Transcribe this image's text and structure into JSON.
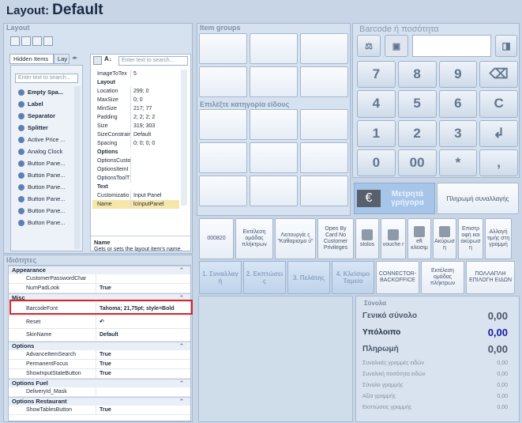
{
  "window": {
    "label": "Layout:",
    "value": "Default"
  },
  "layout_group": {
    "title": "Layout",
    "tabs": [
      "Hidden Items",
      "Lay"
    ],
    "search_placeholder": "Enter text to search...",
    "hidden_items": [
      "Empty Spa...",
      "Label",
      "Separator",
      "Splitter",
      "Active Price ...",
      "Analog Clock",
      "Button Pane...",
      "Button Pane...",
      "Button Pane...",
      "Button Pane...",
      "Button Pane...",
      "Button Pane..."
    ]
  },
  "props_mini": {
    "search_placeholder": "Enter text to search...",
    "rows": [
      {
        "k": "ImageToTex",
        "v": "5"
      },
      {
        "k": "Layout",
        "v": "",
        "cat": true
      },
      {
        "k": "Location",
        "v": "299; 0"
      },
      {
        "k": "MaxSize",
        "v": "0; 0"
      },
      {
        "k": "MinSize",
        "v": "217; 77"
      },
      {
        "k": "Padding",
        "v": "2; 2; 2; 2"
      },
      {
        "k": "Size",
        "v": "319; 303"
      },
      {
        "k": "SizeConstrain",
        "v": "Default"
      },
      {
        "k": "Spacing",
        "v": "0; 0; 0; 0"
      },
      {
        "k": "Options",
        "v": "",
        "cat": true
      },
      {
        "k": "OptionsCusto",
        "v": ""
      },
      {
        "k": "OptionsItemI",
        "v": ""
      },
      {
        "k": "OptionsToolT",
        "v": ""
      },
      {
        "k": "Text",
        "v": "",
        "cat": true
      },
      {
        "k": "Customizatio",
        "v": "Input Panel"
      },
      {
        "k": "Name",
        "v": "lcInputPanel"
      }
    ],
    "desc_title": "Name",
    "desc_text": "Gets or sets the layout item's name."
  },
  "item_groups": {
    "title": "Item groups",
    "category_title": "Επιλέξτε κατηγορία είδους"
  },
  "barcode": {
    "title": "Barcode ή ποσότητα",
    "keys": [
      "7",
      "8",
      "9",
      "⌫",
      "4",
      "5",
      "6",
      "C",
      "1",
      "2",
      "3",
      "↲",
      "0",
      "00",
      "*",
      ","
    ],
    "cash_label": "Μετρητά γρήγορα",
    "pay_label": "Πληρωμή συναλλαγής"
  },
  "function_buttons": [
    "000820",
    "Εκτέλεση ομάδας πλήκτρων",
    "Λειτουργίε ς \"Καθαρισμο ύ\"",
    "Open By Card No Customer Privileges",
    "stolos",
    "vouche r",
    "eft κλεισιμ",
    "Ακύρωσ η",
    "Επιστρ οφή και ακύρωσ η",
    "Αλλαγή τιμής στη γραμμή"
  ],
  "tab_buttons": [
    "1. Συναλλαγ ή",
    "2. Εκπτώσει ς",
    "3. Πελάτης",
    "4. Κλείσιμο Ταμείο",
    "CONNECTOR-BACKOFFICE",
    "Εκτέλεση ομάδας πλήκτρων",
    "ΠΟΛΛΑΠΛΗ ΕΠΙΛΟΓΗ ΕΙΔΩΝ"
  ],
  "summary": {
    "title": "Σύνολα",
    "rows": [
      {
        "label": "Γενικό σύνολο",
        "value": "0,00",
        "style": "big"
      },
      {
        "label": "Υπόλοιπο",
        "value": "0,00",
        "style": "blue"
      },
      {
        "label": "Πληρωμή",
        "value": "0,00",
        "style": "big"
      },
      {
        "label": "Συνολικές γραμμές ειδών",
        "value": "0,00",
        "style": "small"
      },
      {
        "label": "Συνολική ποσότητα ειδών",
        "value": "0,00",
        "style": "small"
      },
      {
        "label": "Σύνολο γραμμής",
        "value": "0,00",
        "style": "small"
      },
      {
        "label": "Αξία γραμμής",
        "value": "0,00",
        "style": "small"
      },
      {
        "label": "Εκπτώσεις γραμμής",
        "value": "0,00",
        "style": "small"
      }
    ]
  },
  "properties": {
    "title": "Ιδιότητες",
    "groups": [
      {
        "name": "Appearance",
        "rows": [
          {
            "k": "CustomerPasswordChar",
            "v": ""
          },
          {
            "k": "NumPadLook",
            "v": "True"
          }
        ]
      },
      {
        "name": "Misc",
        "rows": [
          {
            "k": "BarcodeFont",
            "v": "Tahoma; 21,75pt; style=Bold"
          },
          {
            "k": "Reset",
            "v": "↶"
          },
          {
            "k": "SkinName",
            "v": "Default"
          }
        ]
      },
      {
        "name": "Options",
        "rows": [
          {
            "k": "AdvanceItemSearch",
            "v": "True"
          },
          {
            "k": "PermanentFocus",
            "v": "True"
          },
          {
            "k": "ShowInputStateButton",
            "v": "True"
          }
        ]
      },
      {
        "name": "Options Fuel",
        "rows": [
          {
            "k": "DeliveryId_Mask",
            "v": ""
          }
        ]
      },
      {
        "name": "Options Restaurant",
        "rows": [
          {
            "k": "ShowTablesButton",
            "v": "True"
          }
        ]
      }
    ]
  },
  "colors": {
    "highlight": "#d8232a",
    "blue_value": "#1a1aa6",
    "cash_bg": "#9bbde4"
  }
}
